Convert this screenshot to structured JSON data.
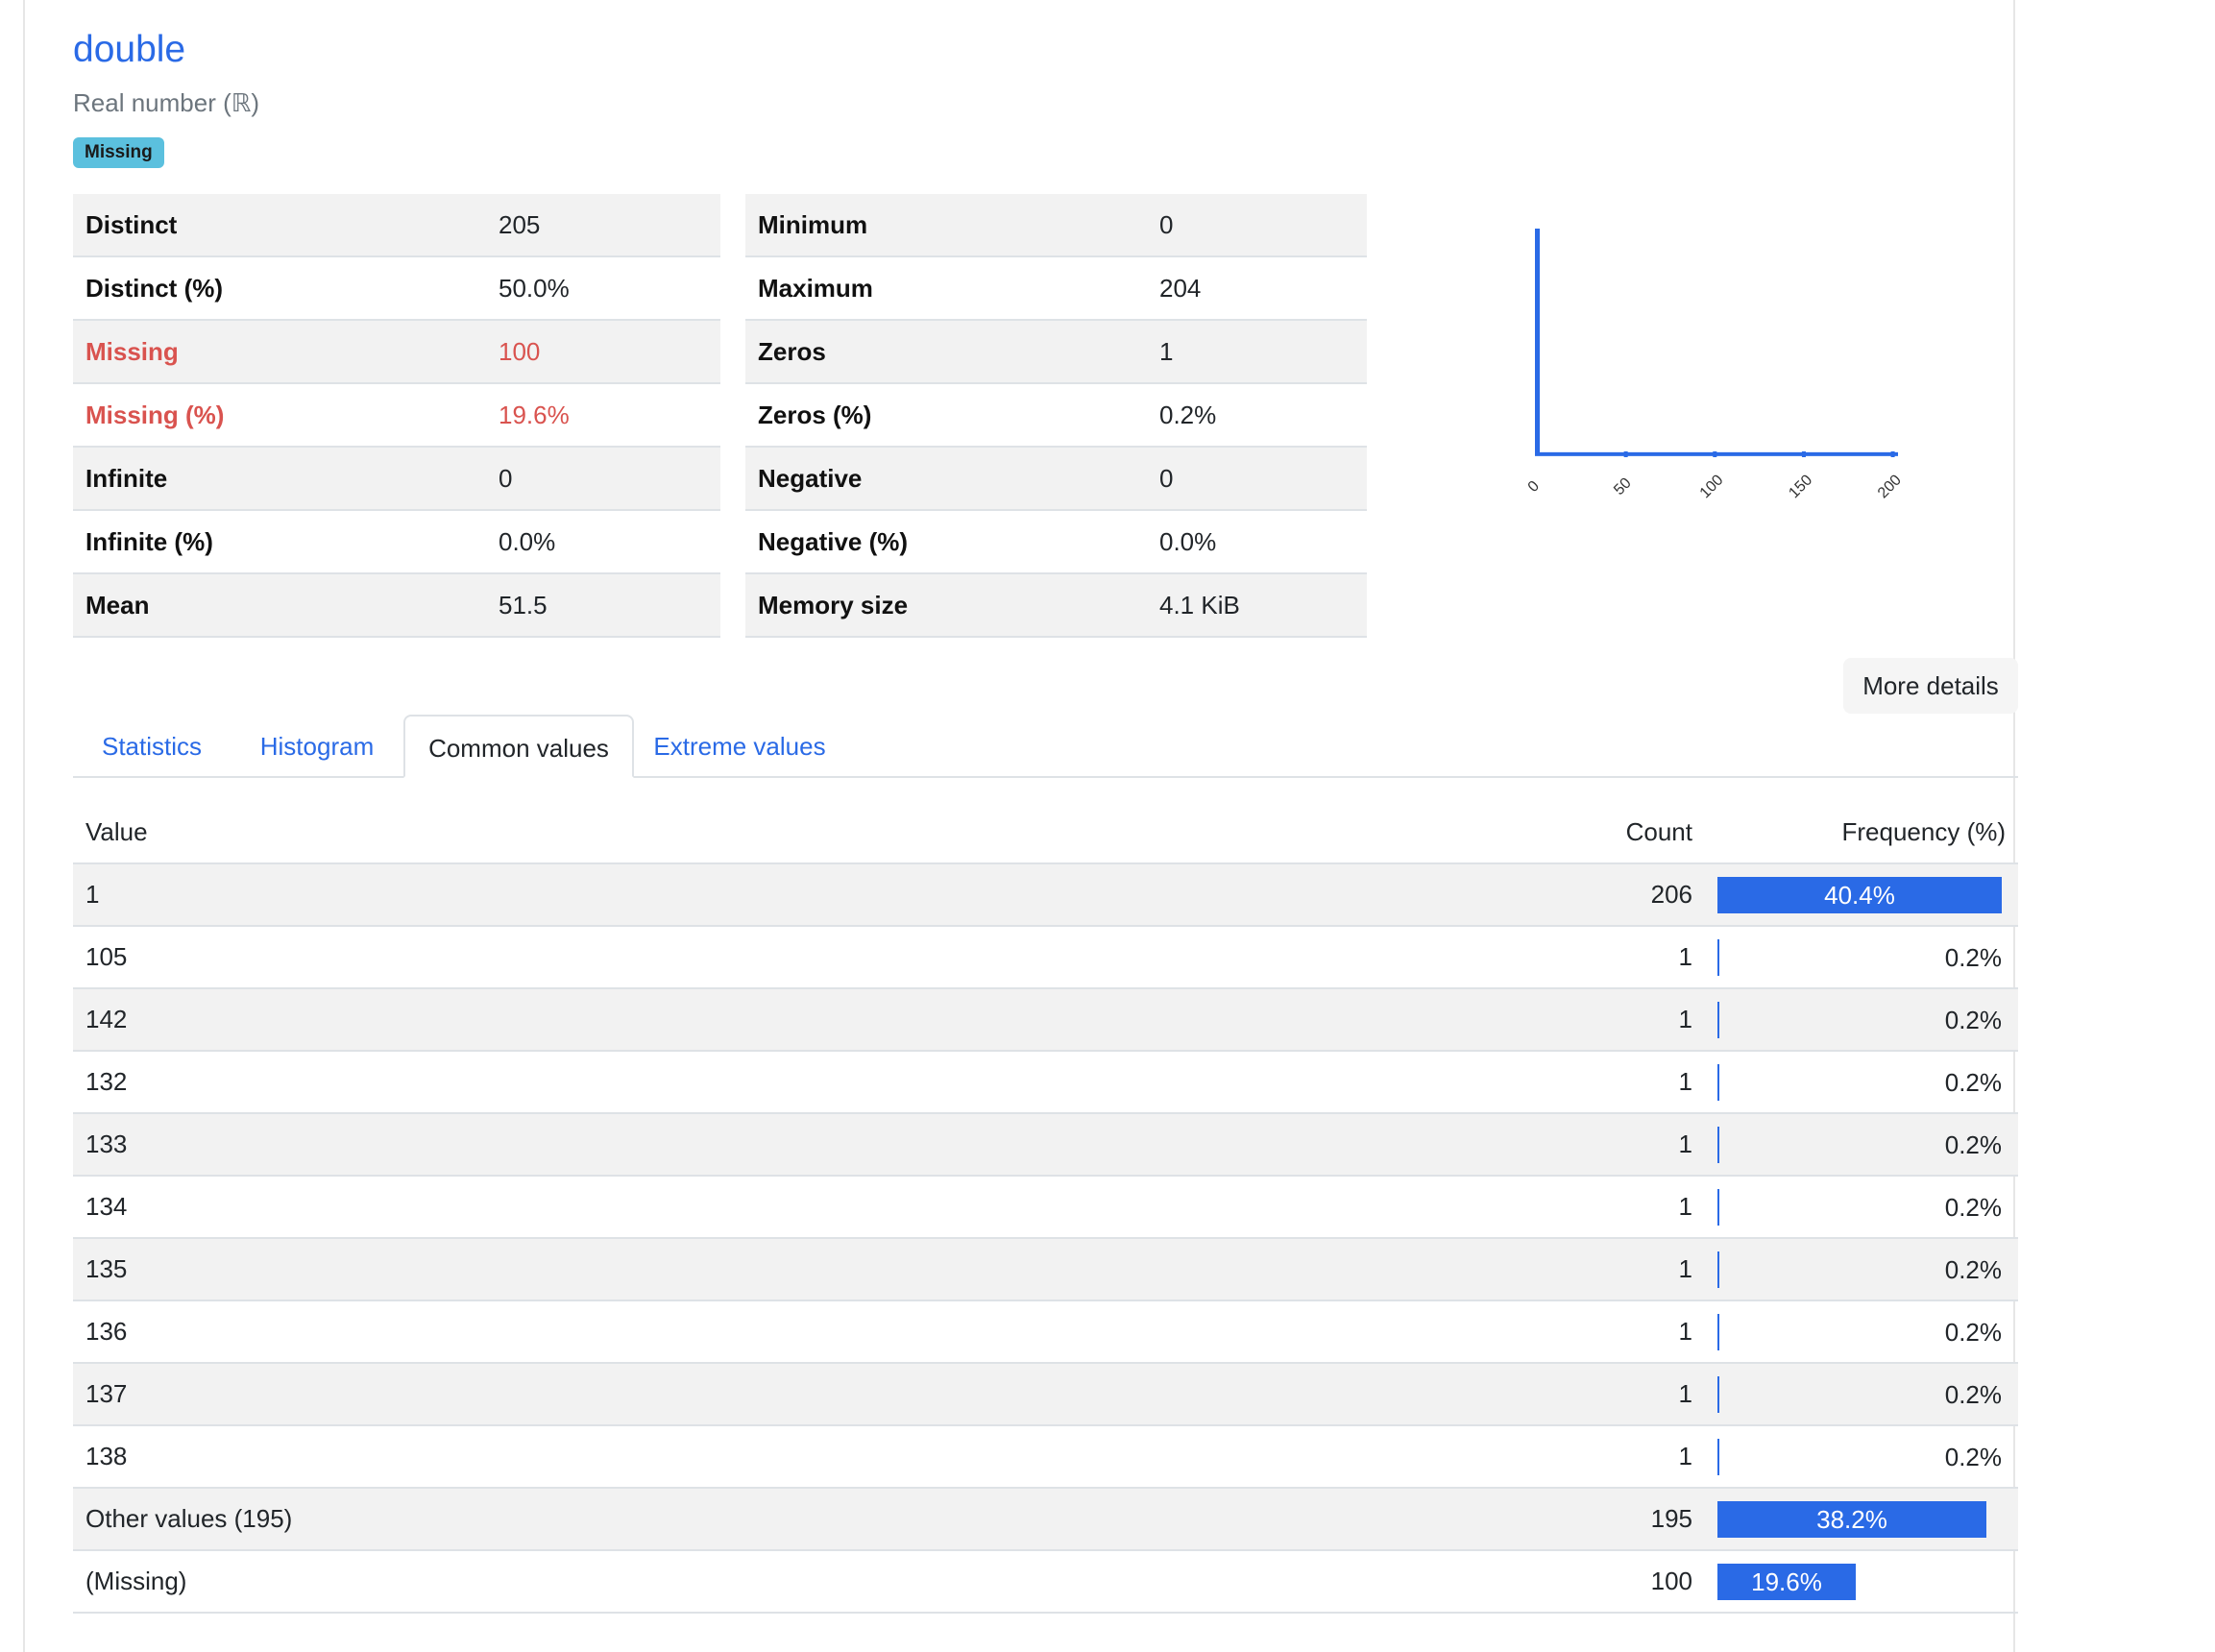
{
  "variable": {
    "name": "double",
    "type": "Real number (ℝ)",
    "badge": "Missing"
  },
  "stats_left": [
    {
      "label": "Distinct",
      "value": "205",
      "warn": false
    },
    {
      "label": "Distinct (%)",
      "value": "50.0%",
      "warn": false
    },
    {
      "label": "Missing",
      "value": "100",
      "warn": true
    },
    {
      "label": "Missing (%)",
      "value": "19.6%",
      "warn": true
    },
    {
      "label": "Infinite",
      "value": "0",
      "warn": false
    },
    {
      "label": "Infinite (%)",
      "value": "0.0%",
      "warn": false
    },
    {
      "label": "Mean",
      "value": "51.5",
      "warn": false
    }
  ],
  "stats_right": [
    {
      "label": "Minimum",
      "value": "0"
    },
    {
      "label": "Maximum",
      "value": "204"
    },
    {
      "label": "Zeros",
      "value": "1"
    },
    {
      "label": "Zeros (%)",
      "value": "0.2%"
    },
    {
      "label": "Negative",
      "value": "0"
    },
    {
      "label": "Negative (%)",
      "value": "0.0%"
    },
    {
      "label": "Memory size",
      "value": "4.1 KiB"
    }
  ],
  "chart_data": {
    "type": "bar",
    "title": "",
    "xlabel": "",
    "ylabel": "",
    "x_ticks": [
      "0",
      "50",
      "100",
      "150",
      "200"
    ],
    "xlim": [
      0,
      204
    ],
    "bins": [
      {
        "x": 0,
        "count": 206
      },
      {
        "x": 50,
        "count": 1
      },
      {
        "x": 100,
        "count": 1
      },
      {
        "x": 150,
        "count": 1
      },
      {
        "x": 200,
        "count": 1
      }
    ],
    "baseline_count": 1,
    "color": "#2a6ae6"
  },
  "more_details_label": "More details",
  "tabs": [
    {
      "label": "Statistics",
      "active": false
    },
    {
      "label": "Histogram",
      "active": false
    },
    {
      "label": "Common values",
      "active": true
    },
    {
      "label": "Extreme values",
      "active": false
    }
  ],
  "freq_table": {
    "headers": {
      "value": "Value",
      "count": "Count",
      "frequency": "Frequency (%)"
    },
    "rows": [
      {
        "value": "1",
        "count": "206",
        "freq_label": "40.4%",
        "freq": 40.4
      },
      {
        "value": "105",
        "count": "1",
        "freq_label": "0.2%",
        "freq": 0.2
      },
      {
        "value": "142",
        "count": "1",
        "freq_label": "0.2%",
        "freq": 0.2
      },
      {
        "value": "132",
        "count": "1",
        "freq_label": "0.2%",
        "freq": 0.2
      },
      {
        "value": "133",
        "count": "1",
        "freq_label": "0.2%",
        "freq": 0.2
      },
      {
        "value": "134",
        "count": "1",
        "freq_label": "0.2%",
        "freq": 0.2
      },
      {
        "value": "135",
        "count": "1",
        "freq_label": "0.2%",
        "freq": 0.2
      },
      {
        "value": "136",
        "count": "1",
        "freq_label": "0.2%",
        "freq": 0.2
      },
      {
        "value": "137",
        "count": "1",
        "freq_label": "0.2%",
        "freq": 0.2
      },
      {
        "value": "138",
        "count": "1",
        "freq_label": "0.2%",
        "freq": 0.2
      },
      {
        "value": "Other values (195)",
        "count": "195",
        "freq_label": "38.2%",
        "freq": 38.2
      },
      {
        "value": "(Missing)",
        "count": "100",
        "freq_label": "19.6%",
        "freq": 19.6
      }
    ]
  },
  "colors": {
    "accent": "#2a6ae6",
    "warn": "#d9534f",
    "badge": "#5bc0de"
  }
}
